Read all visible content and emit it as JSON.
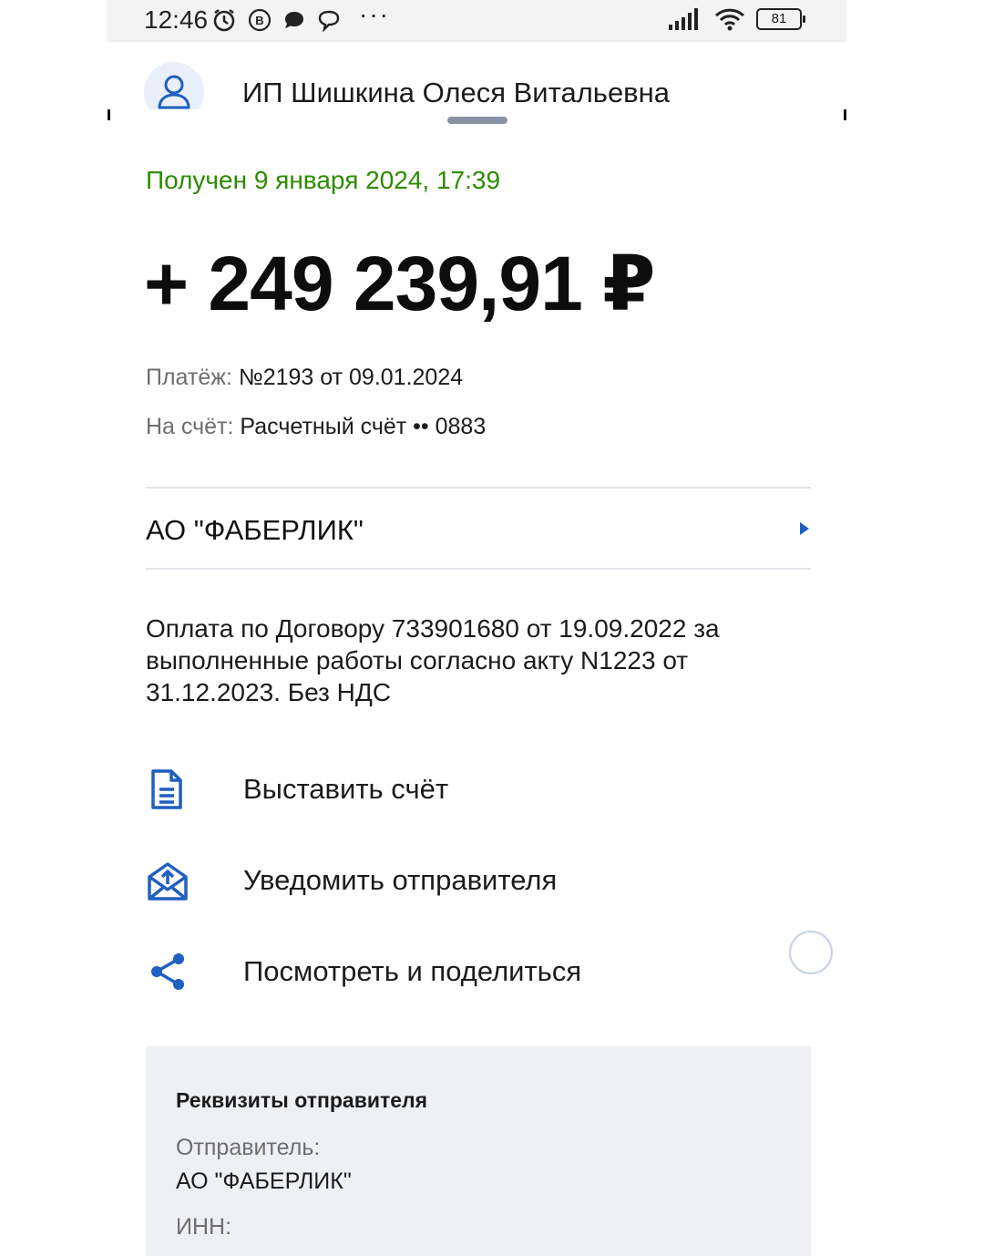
{
  "status_bar": {
    "time": "12:46",
    "battery": "81"
  },
  "header": {
    "name": "ИП Шишкина Олеся Витальевна"
  },
  "transaction": {
    "received": "Получен 9 января 2024, 17:39",
    "amount": "+ 249 239,91 ₽"
  },
  "details": {
    "payment_label": "Платёж: ",
    "payment_value": "№2193 от 09.01.2024",
    "account_label": "На счёт: ",
    "account_value": "Расчетный счёт •• 0883"
  },
  "counterparty": {
    "name": "АО \"ФАБЕРЛИК\""
  },
  "purpose": "Оплата по Договору 733901680 от 19.09.2022 за выполненные работы согласно акту N1223 от 31.12.2023. Без НДС",
  "actions": [
    {
      "label": "Выставить счёт",
      "icon": "document-icon"
    },
    {
      "label": "Уведомить отправителя",
      "icon": "envelope-notify-icon"
    },
    {
      "label": "Посмотреть и поделиться",
      "icon": "share-icon"
    }
  ],
  "sender": {
    "title": "Реквизиты отправителя",
    "sender_label": "Отправитель:",
    "sender_value": "АО \"ФАБЕРЛИК\"",
    "inn_label": "ИНН:"
  },
  "colors": {
    "accent": "#1f5fbf",
    "success": "#2e8b00",
    "card_bg": "#eef0f3"
  }
}
